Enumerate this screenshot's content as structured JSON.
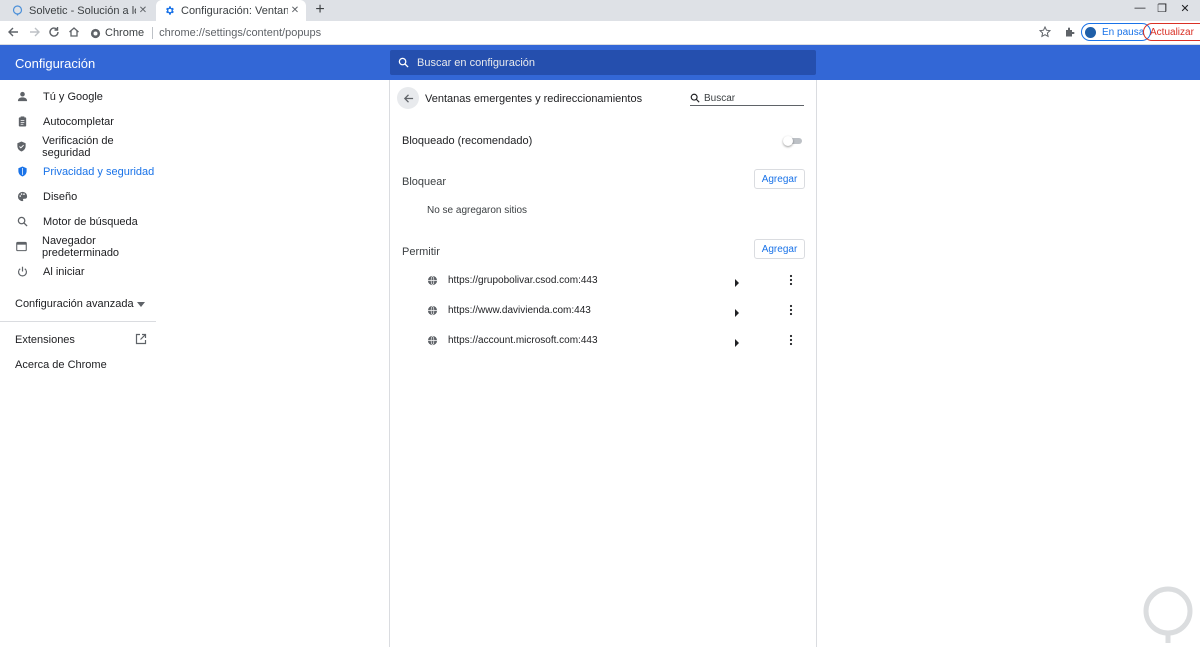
{
  "tabs": [
    {
      "title": "Solvetic - Solución a los problemas",
      "active": false
    },
    {
      "title": "Configuración: Ventanas emergentes",
      "active": true
    }
  ],
  "toolbar": {
    "site_label": "Chrome",
    "url": "chrome://settings/content/popups",
    "profile_label": "En pausa",
    "update_label": "Actualizar"
  },
  "header": {
    "title": "Configuración",
    "search_placeholder": "Buscar en configuración"
  },
  "sidebar": {
    "items": [
      {
        "label": "Tú y Google",
        "icon": "person-icon",
        "selected": false
      },
      {
        "label": "Autocompletar",
        "icon": "clipboard-icon",
        "selected": false
      },
      {
        "label": "Verificación de seguridad",
        "icon": "shield-check-icon",
        "selected": false
      },
      {
        "label": "Privacidad y seguridad",
        "icon": "shield-icon",
        "selected": true
      },
      {
        "label": "Diseño",
        "icon": "palette-icon",
        "selected": false
      },
      {
        "label": "Motor de búsqueda",
        "icon": "search-icon",
        "selected": false
      },
      {
        "label": "Navegador predeterminado",
        "icon": "browser-icon",
        "selected": false
      },
      {
        "label": "Al iniciar",
        "icon": "power-icon",
        "selected": false
      }
    ],
    "advanced_label": "Configuración avanzada",
    "extensions_label": "Extensiones",
    "about_label": "Acerca de Chrome"
  },
  "main": {
    "title": "Ventanas emergentes y redireccionamientos",
    "search_placeholder": "Buscar",
    "blocked_label": "Bloqueado (recomendado)",
    "blocked_enabled": false,
    "block_section": "Bloquear",
    "allow_section": "Permitir",
    "add_label": "Agregar",
    "empty_message": "No se agregaron sitios",
    "allowed_sites": [
      "https://grupobolivar.csod.com:443",
      "https://www.davivienda.com:443",
      "https://account.microsoft.com:443"
    ]
  },
  "colors": {
    "header": "#3367d6",
    "accent": "#1a73e8",
    "update": "#d93025"
  }
}
